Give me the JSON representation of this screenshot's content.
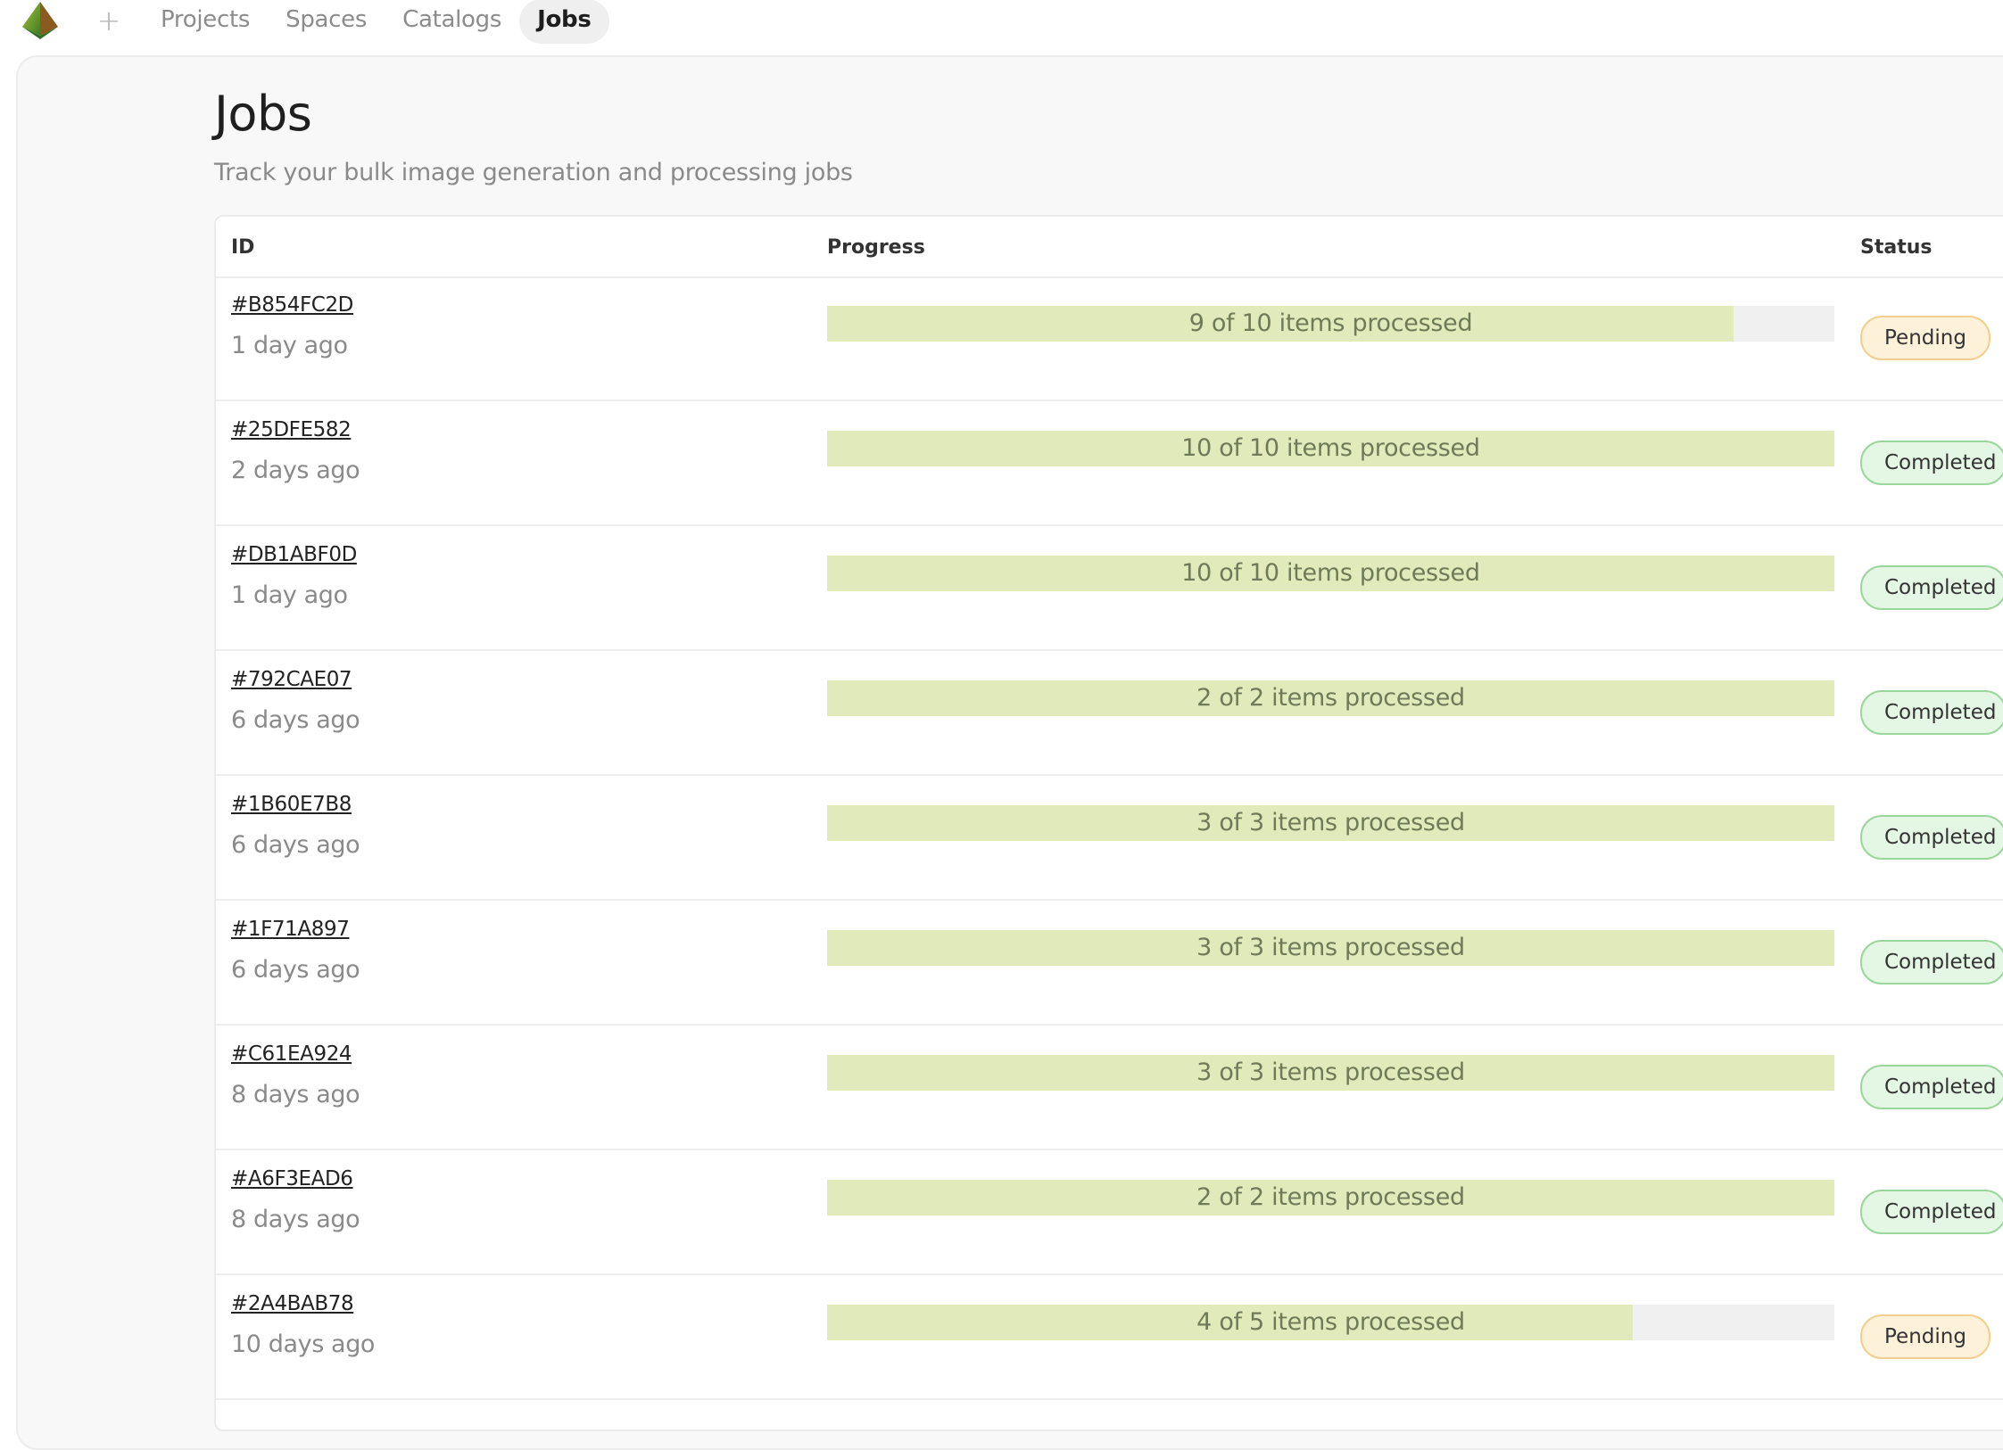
{
  "nav": {
    "add_label": "+",
    "items": [
      "Projects",
      "Spaces",
      "Catalogs",
      "Jobs"
    ],
    "active": "Jobs"
  },
  "page": {
    "title": "Jobs",
    "subtitle": "Track your bulk image generation and processing jobs"
  },
  "table": {
    "columns": [
      "ID",
      "Progress",
      "Status"
    ],
    "rows": [
      {
        "id": "#B854FC2D",
        "time": "1 day ago",
        "progress_label": "9 of 10 items processed",
        "progress": 0.9,
        "status": "Pending"
      },
      {
        "id": "#25DFE582",
        "time": "2 days ago",
        "progress_label": "10 of 10 items processed",
        "progress": 1.0,
        "status": "Completed"
      },
      {
        "id": "#DB1ABF0D",
        "time": "1 day ago",
        "progress_label": "10 of 10 items processed",
        "progress": 1.0,
        "status": "Completed"
      },
      {
        "id": "#792CAE07",
        "time": "6 days ago",
        "progress_label": "2 of 2 items processed",
        "progress": 1.0,
        "status": "Completed"
      },
      {
        "id": "#1B60E7B8",
        "time": "6 days ago",
        "progress_label": "3 of 3 items processed",
        "progress": 1.0,
        "status": "Completed"
      },
      {
        "id": "#1F71A897",
        "time": "6 days ago",
        "progress_label": "3 of 3 items processed",
        "progress": 1.0,
        "status": "Completed"
      },
      {
        "id": "#C61EA924",
        "time": "8 days ago",
        "progress_label": "3 of 3 items processed",
        "progress": 1.0,
        "status": "Completed"
      },
      {
        "id": "#A6F3EAD6",
        "time": "8 days ago",
        "progress_label": "2 of 2 items processed",
        "progress": 1.0,
        "status": "Completed"
      },
      {
        "id": "#2A4BAB78",
        "time": "10 days ago",
        "progress_label": "4 of 5 items processed",
        "progress": 0.8,
        "status": "Pending"
      }
    ]
  },
  "colors": {
    "progress_fill": "#e1eabb",
    "progress_track": "#f0f0f0",
    "pending_bg": "#fdf1d9",
    "completed_bg": "#e4f6e4"
  },
  "icons": {
    "logo": "pyramid-logo-icon",
    "add": "plus-icon"
  }
}
